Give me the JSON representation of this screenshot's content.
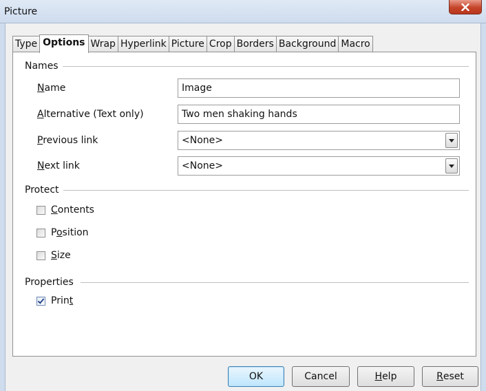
{
  "window": {
    "title": "Picture"
  },
  "tabs": [
    {
      "label": "Type",
      "active": false
    },
    {
      "label": "Options",
      "active": true
    },
    {
      "label": "Wrap",
      "active": false
    },
    {
      "label": "Hyperlink",
      "active": false
    },
    {
      "label": "Picture",
      "active": false
    },
    {
      "label": "Crop",
      "active": false
    },
    {
      "label": "Borders",
      "active": false
    },
    {
      "label": "Background",
      "active": false
    },
    {
      "label": "Macro",
      "active": false
    }
  ],
  "names": {
    "section_title": "Names",
    "name_label_mnemonic": "N",
    "name_label_rest": "ame",
    "name_value": "Image",
    "alt_label_mnemonic": "A",
    "alt_label_rest": "lternative (Text only)",
    "alt_value": "Two men shaking hands",
    "prev_label_mnemonic": "P",
    "prev_label_rest": "revious link",
    "prev_value": "<None>",
    "next_label_mnemonic": "N",
    "next_label_rest": "ext link",
    "next_value": "<None>"
  },
  "protect": {
    "section_title": "Protect",
    "contents_mnemonic": "C",
    "contents_rest": "ontents",
    "contents_checked": false,
    "position_pre": "P",
    "position_mnemonic": "o",
    "position_rest": "sition",
    "position_checked": false,
    "size_mnemonic": "S",
    "size_rest": "ize",
    "size_checked": false
  },
  "properties": {
    "section_title": "Properties",
    "print_pre": "Prin",
    "print_mnemonic": "t",
    "print_checked": true
  },
  "buttons": {
    "ok": "OK",
    "cancel": "Cancel",
    "help_mnemonic": "H",
    "help_rest": "elp",
    "reset_mnemonic": "R",
    "reset_rest": "eset"
  },
  "colors": {
    "accent": "#3c7fb1",
    "close": "#c5442a"
  },
  "icons": {
    "close": "close-icon",
    "dropdown": "chevron-down-icon",
    "check": "checkmark-icon"
  }
}
